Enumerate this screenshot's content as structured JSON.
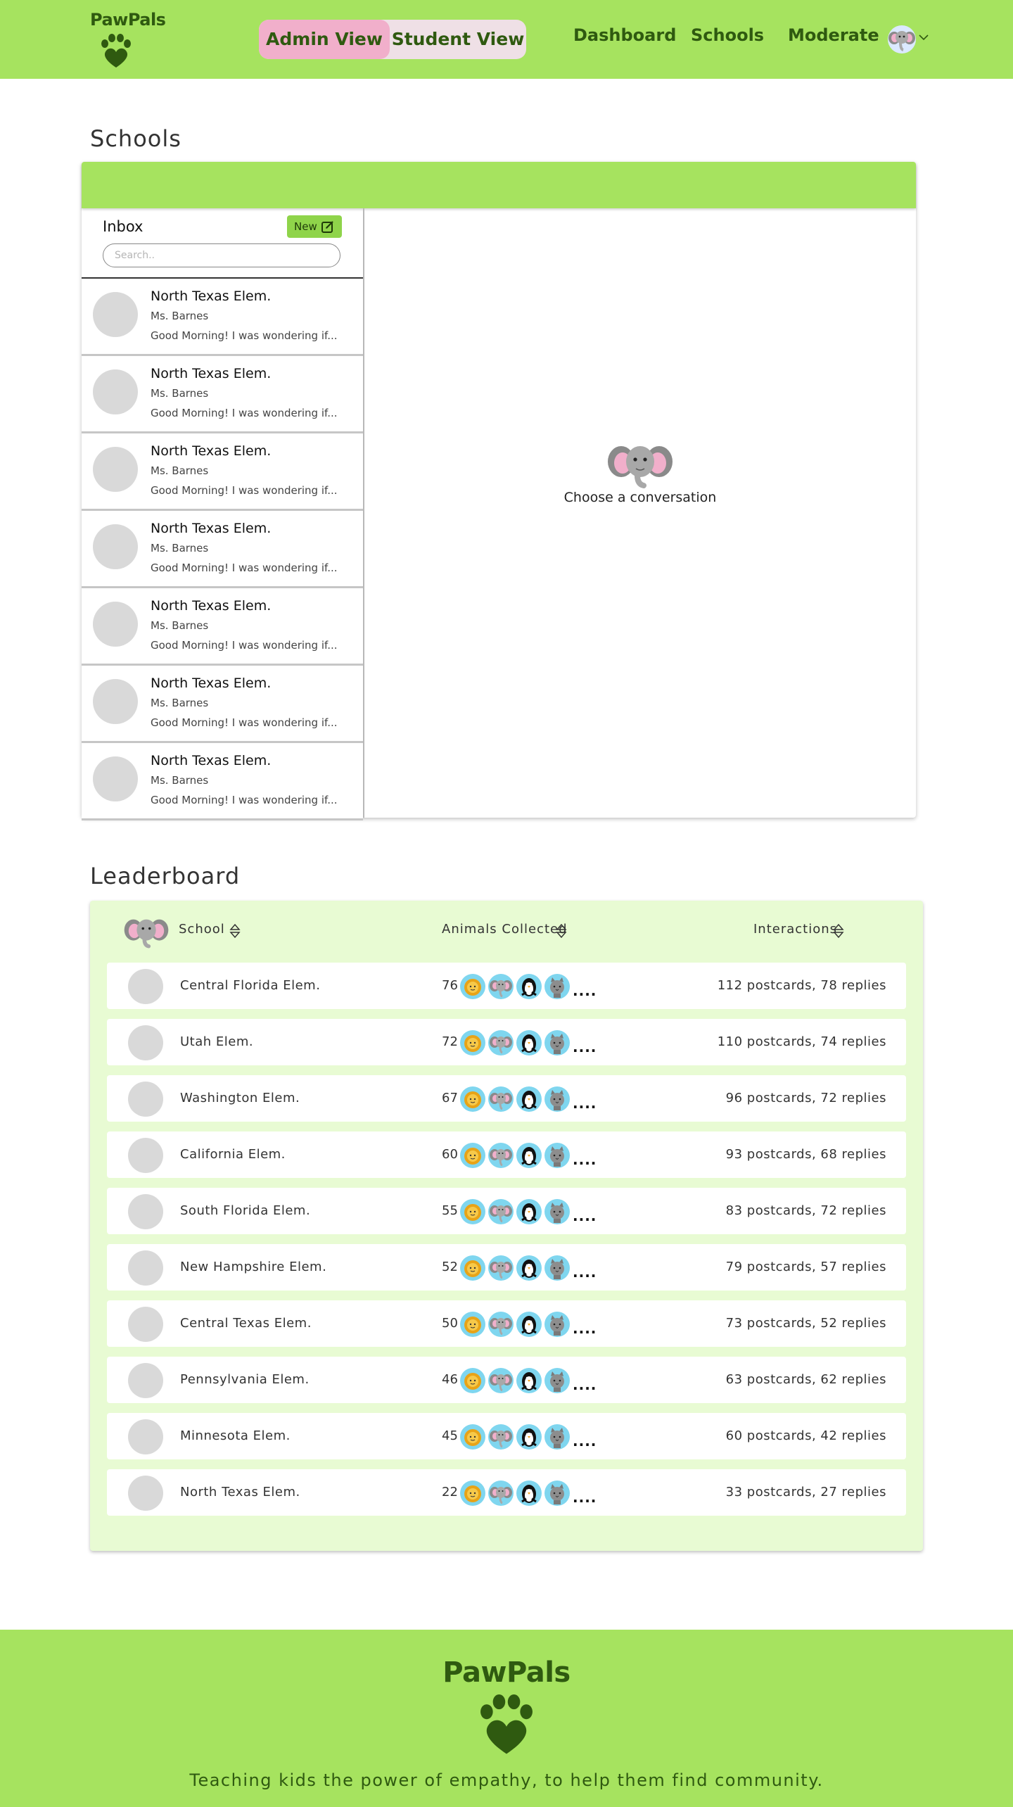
{
  "brand": {
    "name": "PawPals",
    "primary_color": "#a6e35f",
    "dark_color": "#2f5a10",
    "pink_color": "#f1afcb"
  },
  "nav": {
    "view_toggle": {
      "admin_label": "Admin View",
      "student_label": "Student View",
      "selected": "Admin View"
    },
    "links": [
      "Dashboard",
      "Schools",
      "Moderate"
    ],
    "avatar_icon": "elephant-avatar-icon",
    "menu_icon": "chevron-down-icon"
  },
  "schools": {
    "title": "Schools",
    "inbox": {
      "title": "Inbox",
      "new_label": "New",
      "new_icon": "edit-icon",
      "search_placeholder": "Search..",
      "messages": [
        {
          "school": "North Texas Elem.",
          "teacher": "Ms. Barnes",
          "preview": "Good Morning! I was wondering if..."
        },
        {
          "school": "North Texas Elem.",
          "teacher": "Ms. Barnes",
          "preview": "Good Morning! I was wondering if..."
        },
        {
          "school": "North Texas Elem.",
          "teacher": "Ms. Barnes",
          "preview": "Good Morning! I was wondering if..."
        },
        {
          "school": "North Texas Elem.",
          "teacher": "Ms. Barnes",
          "preview": "Good Morning! I was wondering if..."
        },
        {
          "school": "North Texas Elem.",
          "teacher": "Ms. Barnes",
          "preview": "Good Morning! I was wondering if..."
        },
        {
          "school": "North Texas Elem.",
          "teacher": "Ms. Barnes",
          "preview": "Good Morning! I was wondering if..."
        },
        {
          "school": "North Texas Elem.",
          "teacher": "Ms. Barnes",
          "preview": "Good Morning! I was wondering if..."
        }
      ]
    },
    "empty_prompt": "Choose a conversation"
  },
  "leaderboard": {
    "title": "Leaderboard",
    "columns": {
      "school": "School",
      "animals": "Animals Collected",
      "interactions": "Interactions"
    },
    "animal_icons": [
      "lion-icon",
      "elephant-icon",
      "penguin-icon",
      "cat-icon"
    ],
    "more_label": "....",
    "rows": [
      {
        "school": "Central Florida Elem.",
        "animals": "76",
        "interactions": "112 postcards, 78 replies"
      },
      {
        "school": "Utah Elem.",
        "animals": "72",
        "interactions": "110 postcards, 74 replies"
      },
      {
        "school": "Washington Elem.",
        "animals": "67",
        "interactions": "96 postcards, 72 replies"
      },
      {
        "school": "California Elem.",
        "animals": "60",
        "interactions": "93 postcards, 68 replies"
      },
      {
        "school": "South Florida Elem.",
        "animals": "55",
        "interactions": "83 postcards, 72 replies"
      },
      {
        "school": "New Hampshire Elem.",
        "animals": "52",
        "interactions": "79 postcards, 57 replies"
      },
      {
        "school": "Central Texas Elem.",
        "animals": "50",
        "interactions": "73 postcards, 52 replies"
      },
      {
        "school": "Pennsylvania Elem.",
        "animals": "46",
        "interactions": "63 postcards, 62 replies"
      },
      {
        "school": "Minnesota Elem.",
        "animals": "45",
        "interactions": "60 postcards, 42 replies"
      },
      {
        "school": "North Texas Elem.",
        "animals": "22",
        "interactions": "33 postcards, 27 replies"
      }
    ]
  },
  "footer": {
    "brand": "PawPals",
    "tagline": "Teaching kids the power of empathy, to help them find community."
  }
}
